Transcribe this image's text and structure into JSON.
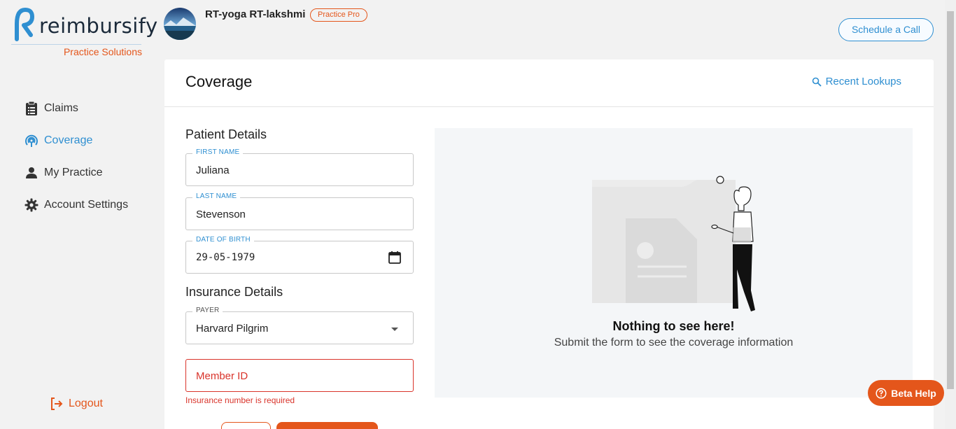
{
  "brand": {
    "name": "reimbursify",
    "subtitle": "Practice Solutions",
    "accent": "#e4561b",
    "primary": "#2f8fd1"
  },
  "sidebar": {
    "items": [
      {
        "label": "Claims",
        "icon": "clipboard-icon",
        "active": false
      },
      {
        "label": "Coverage",
        "icon": "coverage-icon",
        "active": true
      },
      {
        "label": "My Practice",
        "icon": "person-icon",
        "active": false
      },
      {
        "label": "Account Settings",
        "icon": "gear-icon",
        "active": false
      }
    ],
    "logout": "Logout"
  },
  "header": {
    "user_name": "RT-yoga RT-lakshmi",
    "plan_badge": "Practice Pro",
    "schedule_button": "Schedule a Call"
  },
  "page": {
    "title": "Coverage",
    "recent_lookups": "Recent Lookups"
  },
  "form": {
    "patient_section": "Patient Details",
    "first_name": {
      "label": "FIRST NAME",
      "value": "Juliana"
    },
    "last_name": {
      "label": "LAST NAME",
      "value": "Stevenson"
    },
    "dob": {
      "label": "DATE OF BIRTH",
      "value": "29-05-1979"
    },
    "insurance_section": "Insurance Details",
    "payer": {
      "label": "PAYER",
      "value": "Harvard Pilgrim"
    },
    "member_id": {
      "placeholder": "Member ID",
      "error": "Insurance number is required"
    }
  },
  "empty_state": {
    "title": "Nothing to see here!",
    "subtitle": "Submit the form to see the coverage information"
  },
  "beta_help": "Beta Help"
}
